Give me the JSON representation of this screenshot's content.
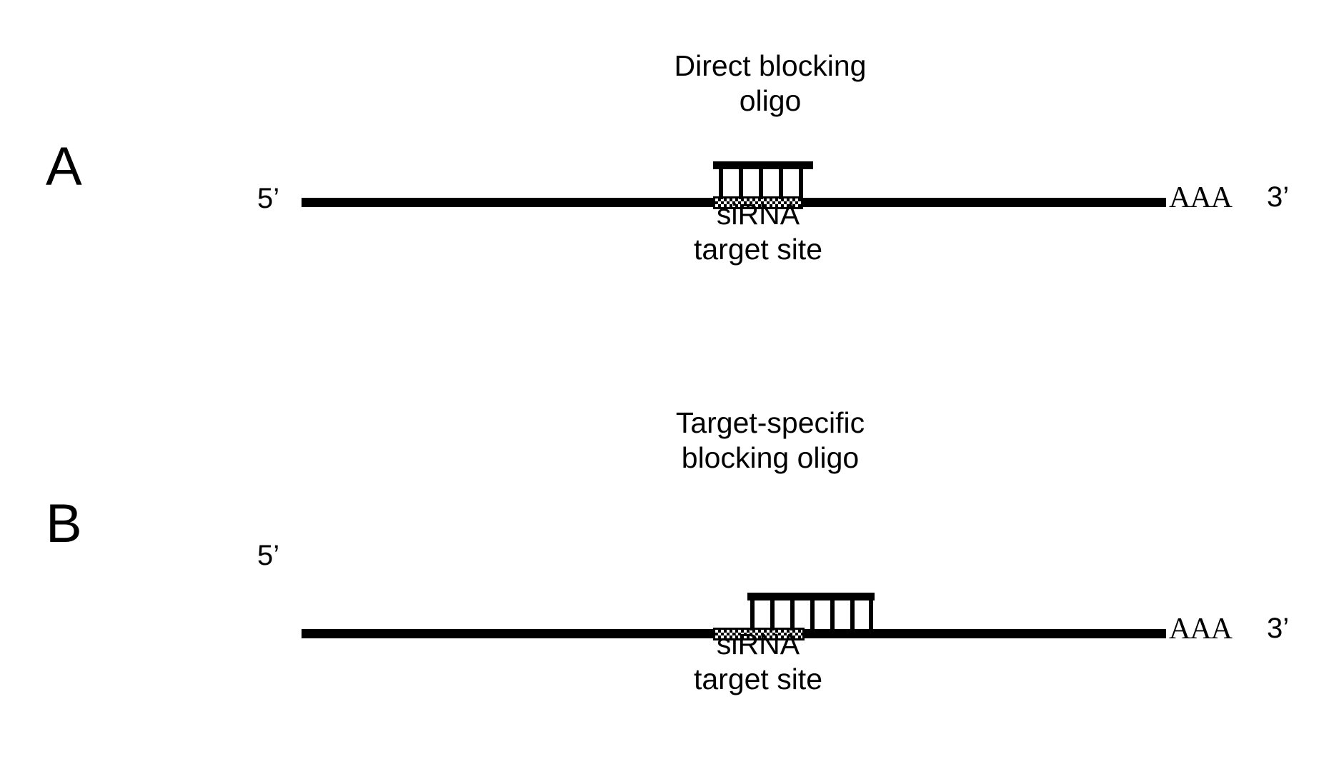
{
  "figure": {
    "type": "diagram",
    "subject": "siRNA target site blocking oligonucleotide schematic",
    "background_color": "#ffffff",
    "ink_color": "#000000"
  },
  "panels": [
    {
      "id": "A",
      "letter": "A",
      "oligo_caption": "Direct blocking\noligo",
      "target_caption": "siRNA\ntarget site",
      "five_prime_label": "5’",
      "three_prime_label": "3’",
      "polya_label": "AAA",
      "oligo_rung_count": 5,
      "alignment_note": "blocking oligo aligned directly over the siRNA target site"
    },
    {
      "id": "B",
      "letter": "B",
      "oligo_caption": "Target-specific\nblocking oligo",
      "target_caption": "siRNA\ntarget site",
      "five_prime_label": "5’",
      "three_prime_label": "3’",
      "polya_label": "AAA",
      "oligo_rung_count": 7,
      "alignment_note": "blocking oligo shifted 3’ of the siRNA target site, overlapping only partially"
    }
  ]
}
